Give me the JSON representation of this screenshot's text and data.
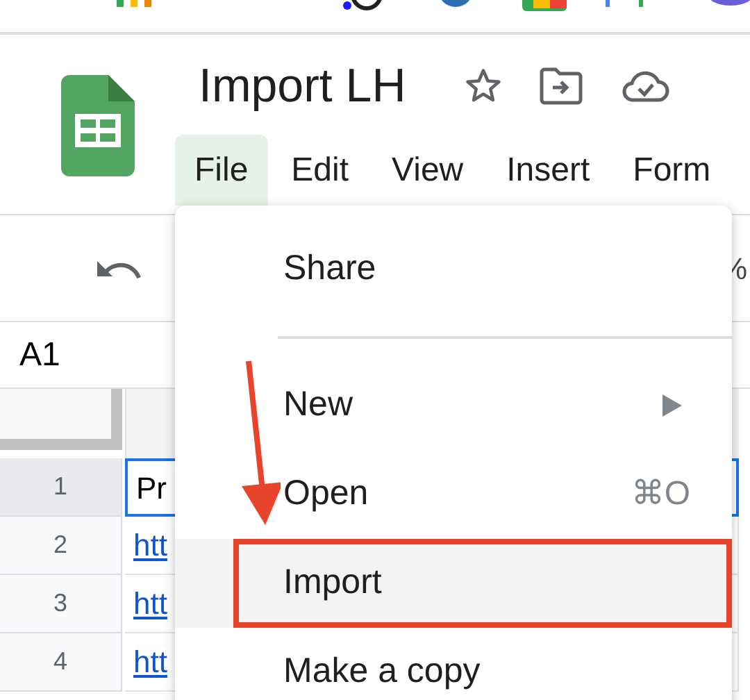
{
  "document": {
    "title": "Import LH"
  },
  "menu_bar": [
    {
      "label": "File",
      "selected": true
    },
    {
      "label": "Edit",
      "selected": false
    },
    {
      "label": "View",
      "selected": false
    },
    {
      "label": "Insert",
      "selected": false
    },
    {
      "label": "Form",
      "selected": false
    }
  ],
  "toolbar": {
    "partial_text": "%"
  },
  "formula_bar": {
    "name_box": "A1"
  },
  "rows": [
    {
      "number": "1",
      "cell": "Pr",
      "kind": "text",
      "selected": true
    },
    {
      "number": "2",
      "cell": "htt",
      "kind": "link",
      "selected": false
    },
    {
      "number": "3",
      "cell": "htt",
      "kind": "link",
      "selected": false
    },
    {
      "number": "4",
      "cell": "htt",
      "kind": "link",
      "selected": false
    }
  ],
  "file_menu": {
    "items": [
      {
        "kind": "item",
        "label": "Share",
        "selected": false,
        "outlined": false
      },
      {
        "kind": "divider"
      },
      {
        "kind": "item",
        "label": "New",
        "submenu": true,
        "selected": false,
        "outlined": false
      },
      {
        "kind": "item",
        "label": "Open",
        "shortcut": "⌘O",
        "selected": false,
        "outlined": false
      },
      {
        "kind": "item",
        "label": "Import",
        "selected": true,
        "outlined": true
      },
      {
        "kind": "item",
        "label": "Make a copy",
        "selected": false,
        "outlined": false
      }
    ]
  }
}
